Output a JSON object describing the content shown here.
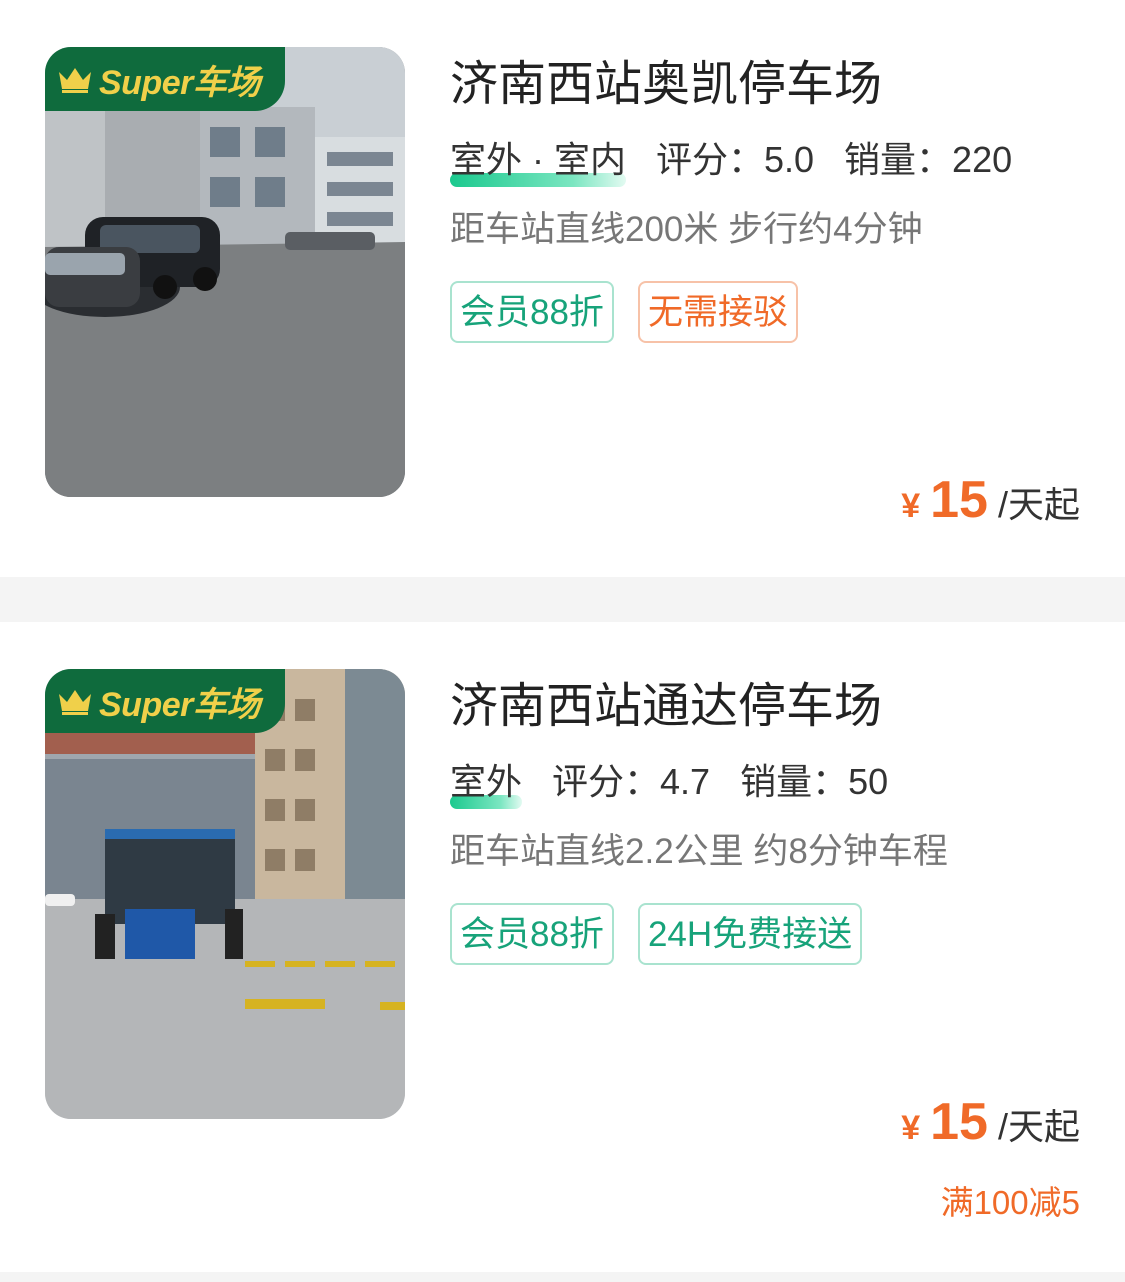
{
  "lots": [
    {
      "badge": "Super车场",
      "name": "济南西站奥凯停车场",
      "type": "室外 · 室内",
      "rating_label": "评分：5.0",
      "sales_label": "销量：220",
      "distance": "距车站直线200米 步行约4分钟",
      "tags": [
        "会员88折",
        "无需接驳"
      ],
      "price_symbol": "¥",
      "price": "15",
      "price_unit": "/天起"
    },
    {
      "badge": "Super车场",
      "name": "济南西站通达停车场",
      "type": "室外",
      "rating_label": "评分：4.7",
      "sales_label": "销量：50",
      "distance": "距车站直线2.2公里 约8分钟车程",
      "tags": [
        "会员88折",
        "24H免费接送"
      ],
      "price_symbol": "¥",
      "price": "15",
      "price_unit": "/天起",
      "promo": "满100减5"
    }
  ],
  "colors": {
    "accent_orange": "#f06a28",
    "accent_green": "#17a37a",
    "badge_green": "#0f6b3d",
    "badge_gold": "#f0d04a"
  },
  "icons": {
    "badge_icon": "crown-icon"
  }
}
